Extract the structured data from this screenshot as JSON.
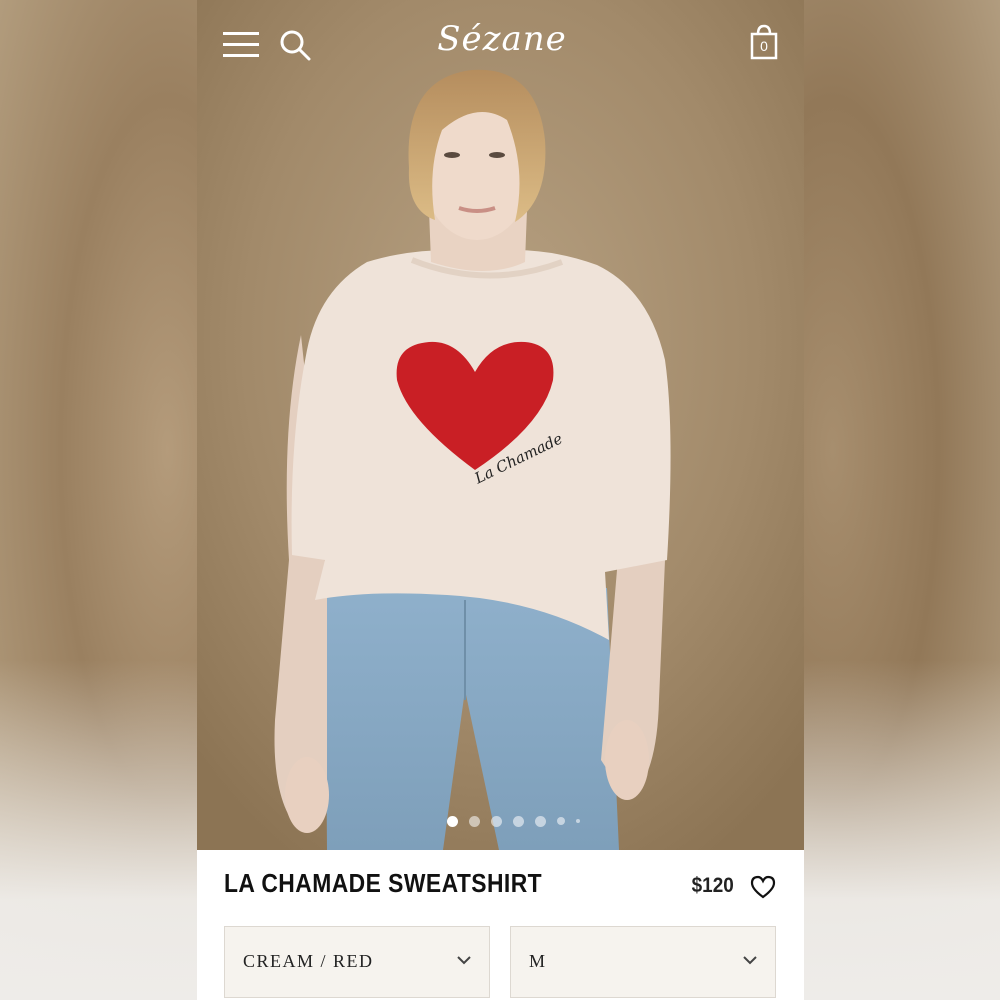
{
  "header": {
    "logo_text": "Sézane",
    "bag_count": "0",
    "icons": [
      "menu-icon",
      "search-icon",
      "shopping-bag-icon"
    ]
  },
  "gallery": {
    "image_count": 7,
    "active_index": 0,
    "print_text": "La Chamade"
  },
  "product": {
    "title": "LA CHAMADE SWEATSHIRT",
    "price": "$120",
    "color_select": "CREAM / RED",
    "size_select": "M"
  },
  "colors": {
    "heart_red": "#c91f25",
    "sweater_cream": "#efe3d9",
    "denim": "#8fb0cb",
    "background_tan": "#a38b6b"
  }
}
